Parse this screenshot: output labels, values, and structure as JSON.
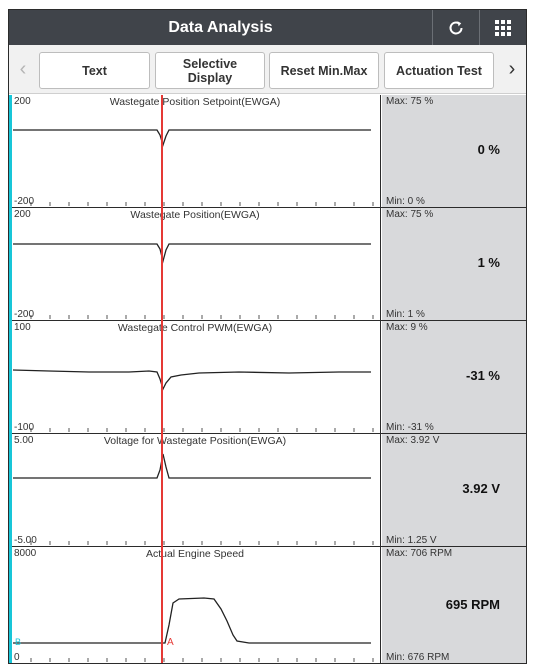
{
  "header": {
    "title": "Data Analysis",
    "refresh_icon": "refresh-icon",
    "grid_icon": "grid-icon"
  },
  "toolbar": {
    "left_arrow": "‹",
    "right_arrow": "›",
    "buttons": [
      "Text",
      "Selective\nDisplay",
      "Reset Min.Max",
      "Actuation Test"
    ]
  },
  "channels": [
    {
      "name": "Wastegate Position Setpoint(EWGA)",
      "y_top": "200",
      "y_bottom": "-200",
      "max": "Max: 75 %",
      "min": "Min: 0 %",
      "value": "0 %"
    },
    {
      "name": "Wastegate Position(EWGA)",
      "y_top": "200",
      "y_bottom": "-200",
      "max": "Max: 75 %",
      "min": "Min: 1 %",
      "value": "1 %"
    },
    {
      "name": "Wastegate Control PWM(EWGA)",
      "y_top": "100",
      "y_bottom": "-100",
      "max": "Max: 9 %",
      "min": "Min: -31 %",
      "value": "-31 %"
    },
    {
      "name": "Voltage for Wastegate Position(EWGA)",
      "y_top": "5.00",
      "y_bottom": "-5.00",
      "max": "Max: 3.92 V",
      "min": "Min: 1.25 V",
      "value": "3.92 V"
    },
    {
      "name": "Actual Engine Speed",
      "y_top": "8000",
      "y_bottom": "0",
      "max": "Max: 706 RPM",
      "min": "Min: 676 RPM",
      "value": "695 RPM"
    }
  ],
  "cursor": {
    "label": "A",
    "left_label": "B"
  },
  "colors": {
    "cursor": "#e53935",
    "left_marker": "#18c6d8",
    "header_bg": "#40444a",
    "panel_bg": "#d8d9db"
  }
}
